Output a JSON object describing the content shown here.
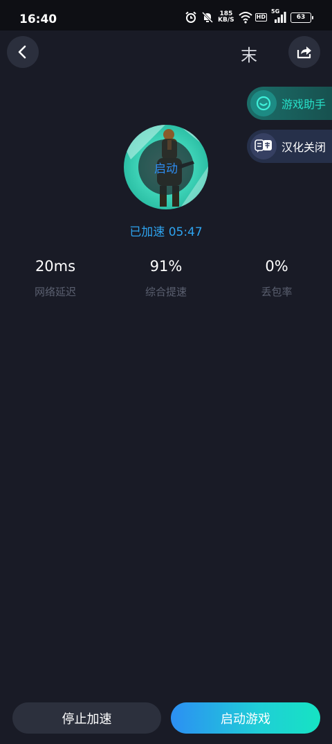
{
  "status_bar": {
    "time": "16:40",
    "net_speed_value": "185",
    "net_speed_unit": "KB/S",
    "hd_label": "HD",
    "network_label": "5G",
    "battery_level": "63",
    "icons": [
      "alarm-icon",
      "mute-icon",
      "wifi-icon",
      "signal-icon",
      "battery-icon"
    ]
  },
  "header": {
    "title_fragment": "末",
    "back_icon": "chevron-left-icon",
    "share_icon": "share-icon"
  },
  "side_tools": {
    "assistant_label": "游戏助手",
    "translate_label": "汉化关闭"
  },
  "game": {
    "launch_label": "启动",
    "accel_status": "已加速 05:47"
  },
  "stats": [
    {
      "value": "20ms",
      "label": "网络延迟"
    },
    {
      "value": "91%",
      "label": "综合提速"
    },
    {
      "value": "0%",
      "label": "丢包率"
    }
  ],
  "actions": {
    "stop_label": "停止加速",
    "start_label": "启动游戏"
  },
  "colors": {
    "background": "#191b26",
    "accent_blue": "#2ea4f0",
    "accent_teal": "#27e0c8",
    "muted_text": "#5b6070"
  }
}
